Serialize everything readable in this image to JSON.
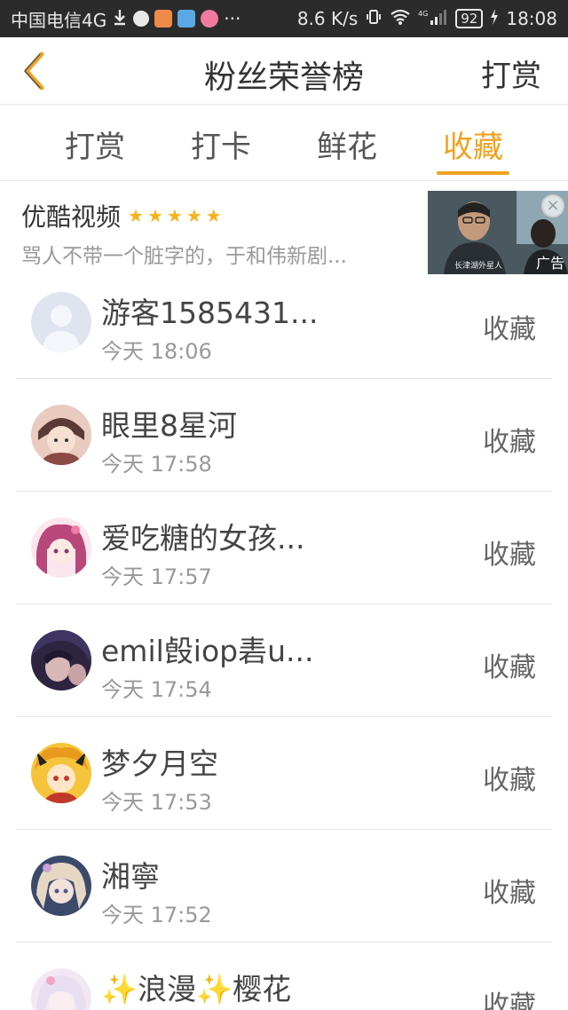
{
  "status_bar": {
    "carrier": "中国电信4G",
    "more": "···",
    "speed": "8.6 K/s",
    "network": "4G",
    "battery": "92",
    "time": "18:08"
  },
  "header": {
    "title": "粉丝荣誉榜",
    "reward": "打赏"
  },
  "tabs": [
    {
      "label": "打赏"
    },
    {
      "label": "打卡"
    },
    {
      "label": "鲜花"
    },
    {
      "label": "收藏"
    }
  ],
  "ad": {
    "title": "优酷视频",
    "subtitle": "骂人不带一个脏字的，于和伟新剧...",
    "label": "广告",
    "caption": "长津湖外星人"
  },
  "rows": [
    {
      "name": "游客1585431...",
      "time": "今天 18:06",
      "action": "收藏"
    },
    {
      "name": "眼里8星河",
      "time": "今天 17:58",
      "action": "收藏"
    },
    {
      "name": "爱吃糖的女孩...",
      "time": "今天 17:57",
      "action": "收藏"
    },
    {
      "name": "emil㲃iop砉u...",
      "time": "今天 17:54",
      "action": "收藏"
    },
    {
      "name": "梦夕月空",
      "time": "今天 17:53",
      "action": "收藏"
    },
    {
      "name": "湘寧",
      "time": "今天 17:52",
      "action": "收藏"
    },
    {
      "name": "✨浪漫✨樱花",
      "time": "",
      "action": "收藏"
    }
  ],
  "colors": {
    "accent": "#f0a21e",
    "star": "#f5b21b",
    "status_bar_bg": "#2b2b2b"
  }
}
